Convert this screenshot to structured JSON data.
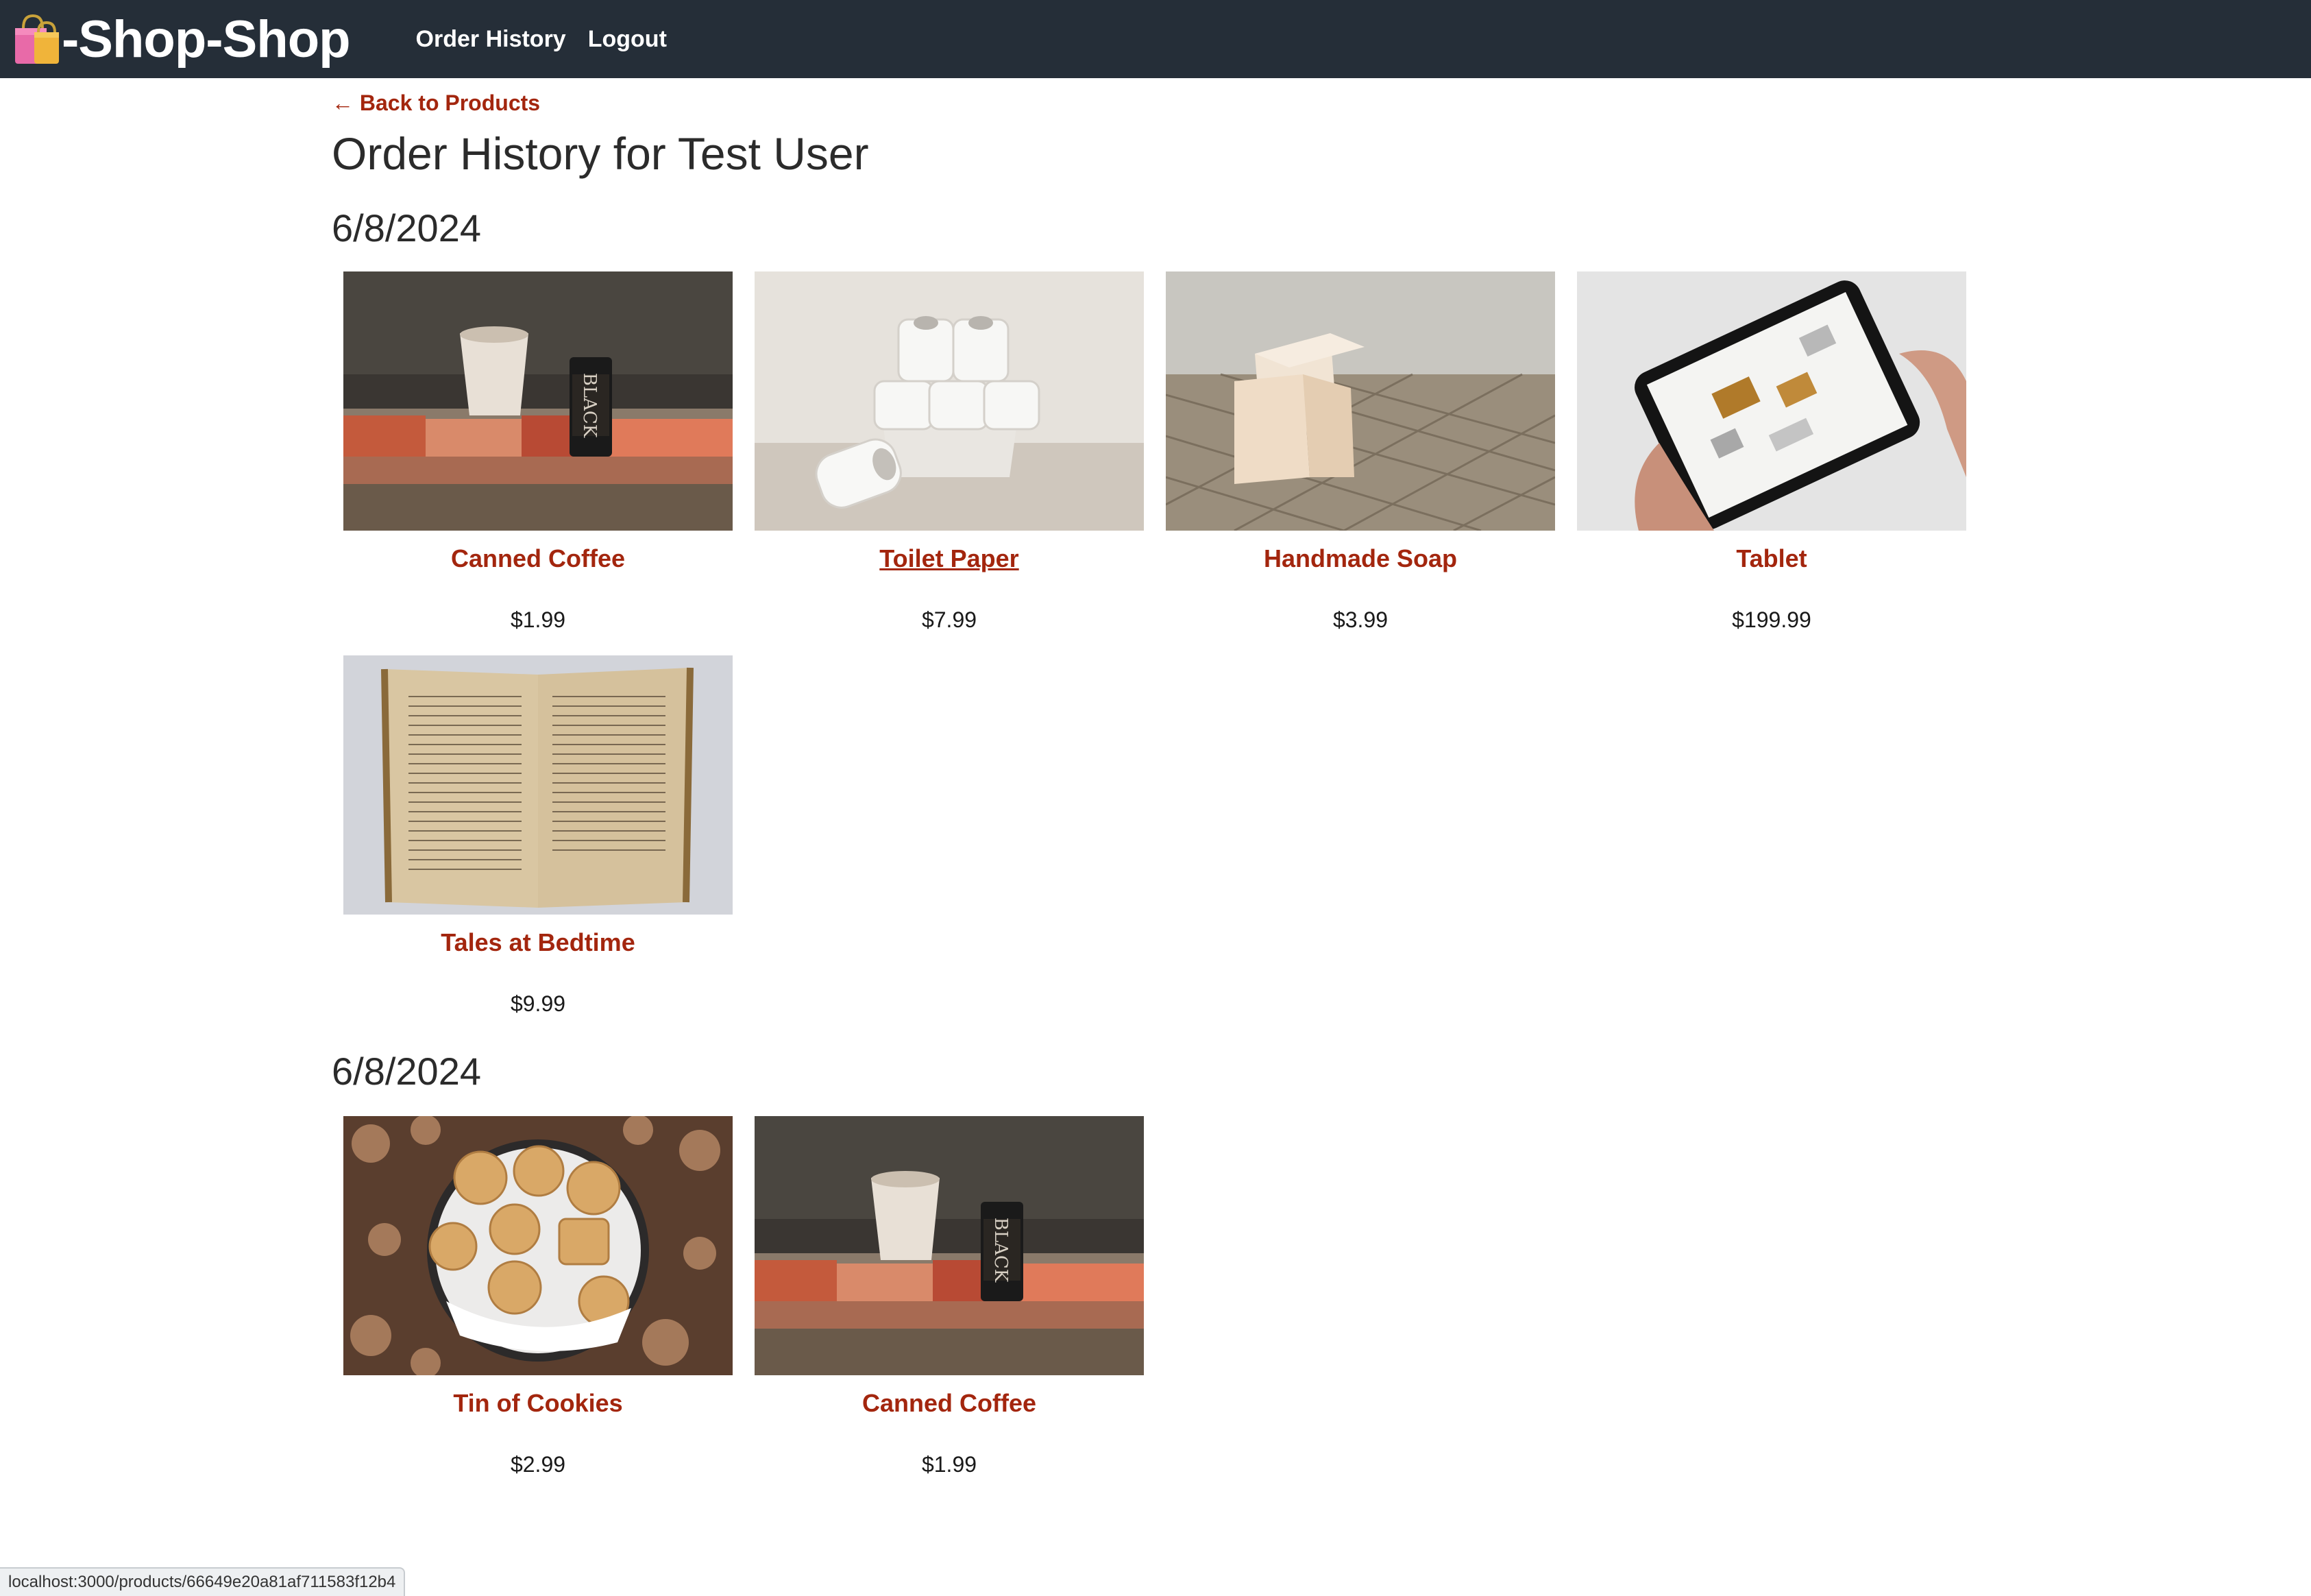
{
  "header": {
    "brand": "-Shop-Shop",
    "nav": {
      "order_history": "Order History",
      "logout": "Logout"
    }
  },
  "back_link": "← Back to Products",
  "page_title": "Order History for Test User",
  "orders": [
    {
      "date": "6/8/2024",
      "items": [
        {
          "name": "Canned Coffee",
          "price": "$1.99",
          "image": "canned-coffee-photo"
        },
        {
          "name": "Toilet Paper",
          "price": "$7.99",
          "image": "toilet-paper-photo"
        },
        {
          "name": "Handmade Soap",
          "price": "$3.99",
          "image": "soap-photo"
        },
        {
          "name": "Tablet",
          "price": "$199.99",
          "image": "tablet-photo"
        },
        {
          "name": "Tales at Bedtime",
          "price": "$9.99",
          "image": "book-photo"
        }
      ]
    },
    {
      "date": "6/8/2024",
      "items": [
        {
          "name": "Tin of Cookies",
          "price": "$2.99",
          "image": "cookies-photo"
        },
        {
          "name": "Canned Coffee",
          "price": "$1.99",
          "image": "canned-coffee-photo"
        }
      ]
    }
  ],
  "status_bar_url": "localhost:3000/products/66649e20a81af711583f12b4",
  "colors": {
    "nav_bg": "#252e38",
    "link": "#a3260e",
    "text": "#2b2b2b"
  }
}
